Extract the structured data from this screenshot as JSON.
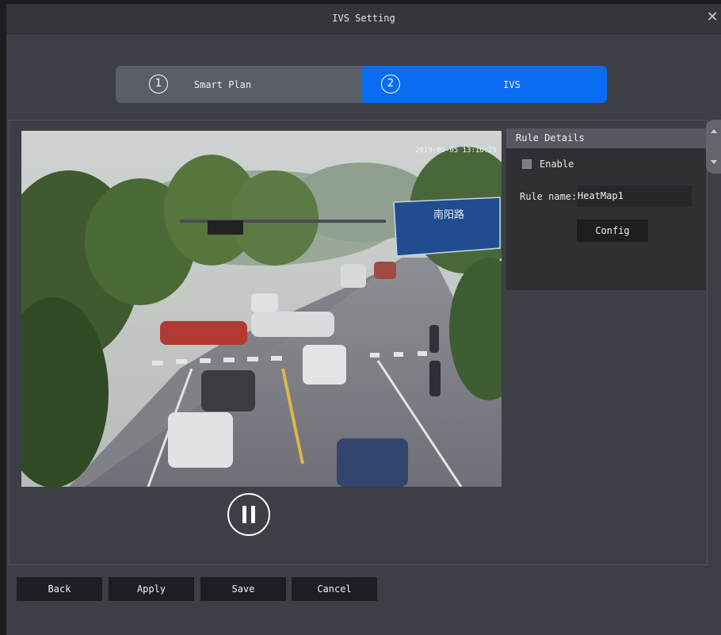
{
  "window": {
    "title": "IVS Setting",
    "close_icon": "close-icon"
  },
  "steps": [
    {
      "number": "1",
      "label": "Smart Plan",
      "active": false
    },
    {
      "number": "2",
      "label": "IVS",
      "active": true
    }
  ],
  "video": {
    "timestamp": "2019-05-05 13:16:25",
    "sign_text": "南阳路",
    "player_state": "playing",
    "control_icon": "pause-icon"
  },
  "rule_details": {
    "header": "Rule Details",
    "enable_label": "Enable",
    "enable_checked": false,
    "rule_name_label": "Rule name:",
    "rule_name_value": "HeatMap1",
    "config_label": "Config"
  },
  "footer": {
    "back_label": "Back",
    "apply_label": "Apply",
    "save_label": "Save",
    "cancel_label": "Cancel"
  },
  "colors": {
    "accent": "#0a6df1",
    "panel": "#3c3f45",
    "button": "#1d1e21"
  }
}
